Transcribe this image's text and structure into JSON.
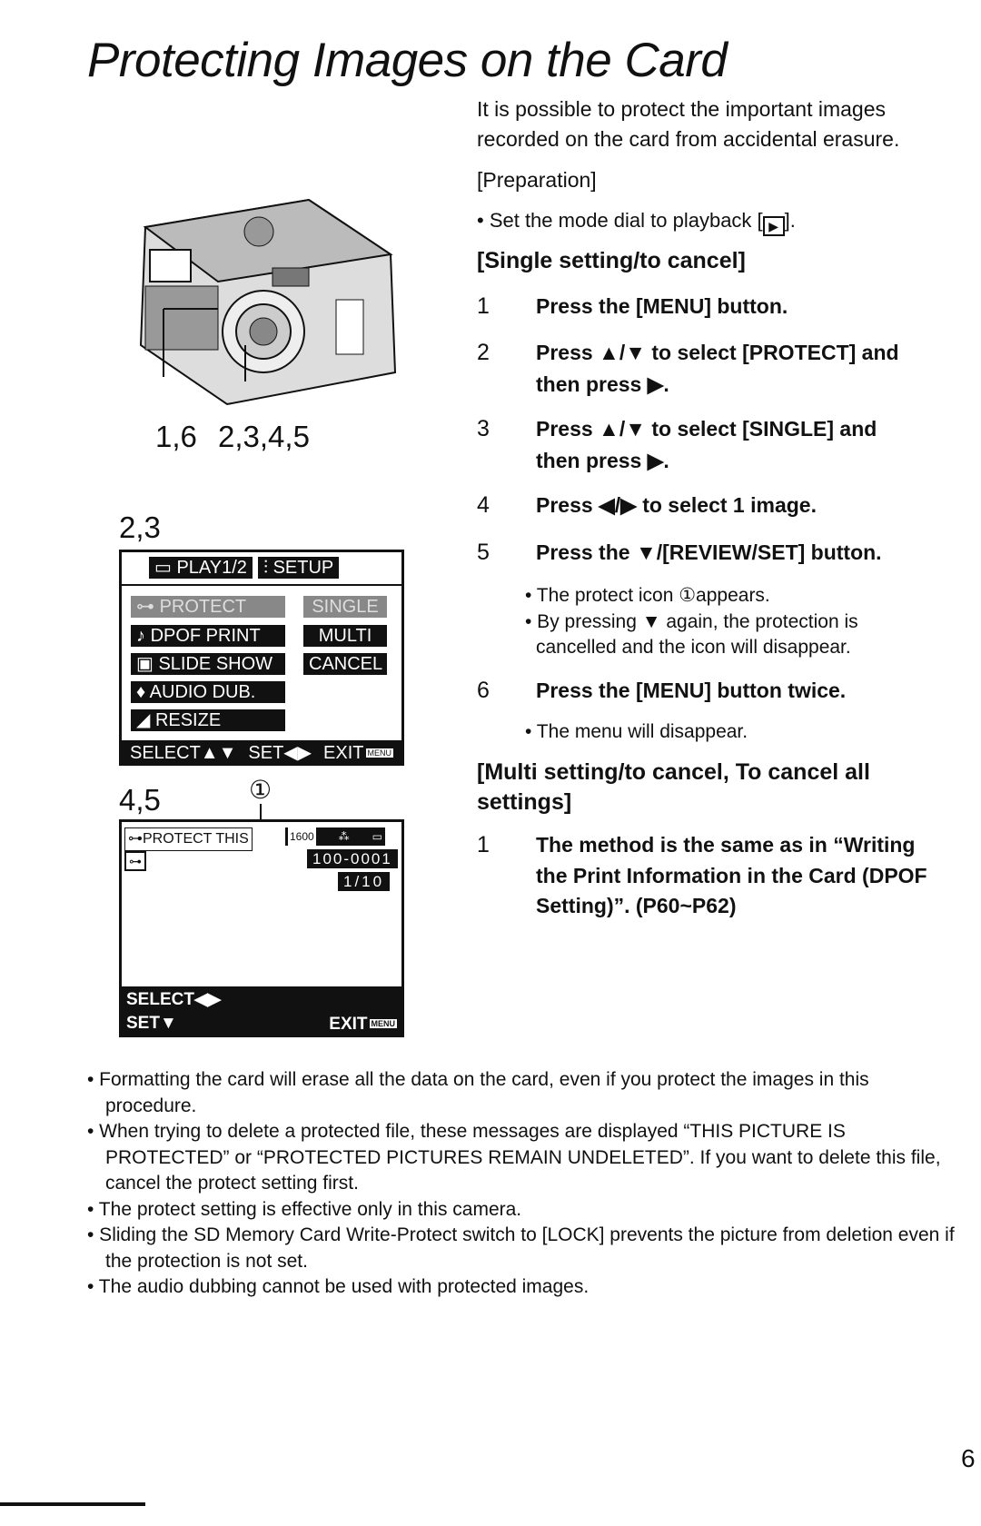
{
  "title": "Protecting Images on the Card",
  "intro": [
    "It is possible to protect the important images",
    "recorded on the card from accidental erasure."
  ],
  "preparation": "[Preparation]",
  "prep_bullet": "• Set the mode dial to playback [",
  "prep_bullet_end": "].",
  "single_heading": "[Single setting/to cancel]",
  "steps": [
    {
      "n": "1",
      "lines": [
        "Press the [MENU] button."
      ]
    },
    {
      "n": "2",
      "lines": [
        "Press ▲/▼ to select [PROTECT] and",
        "then press ▶."
      ]
    },
    {
      "n": "3",
      "lines": [
        "Press ▲/▼ to select [SINGLE] and",
        "then press ▶."
      ]
    },
    {
      "n": "4",
      "lines": [
        "Press ◀/▶ to select 1 image."
      ]
    },
    {
      "n": "5",
      "lines": [
        "Press the ▼/[REVIEW/SET] button."
      ]
    },
    {
      "n": "6",
      "lines": [
        "Press the [MENU] button twice."
      ]
    }
  ],
  "step5_notes": [
    "• The protect icon ①appears.",
    "• By pressing ▼ again, the protection is",
    "cancelled and the icon will disappear."
  ],
  "step6_note": "• The menu will disappear.",
  "multi_heading": [
    "[Multi setting/to cancel, To cancel all",
    "settings]"
  ],
  "multi_step": {
    "n": "1",
    "lines": [
      "The method is the same as in “Writing",
      "the Print Information in the Card (DPOF",
      "Setting)”. (P60~P62)"
    ]
  },
  "camera_labels": {
    "left": "1,6",
    "right": "2,3,4,5"
  },
  "menu_label": "2,3",
  "menu": {
    "tab_play": "PLAY1/2",
    "tab_setup": "SETUP",
    "items": [
      "PROTECT",
      "DPOF PRINT",
      "SLIDE SHOW",
      "AUDIO DUB.",
      "RESIZE"
    ],
    "options": [
      "SINGLE",
      "MULTI",
      "CANCEL"
    ],
    "footer": [
      "SELECT▲▼",
      "SET◀▶",
      "EXIT"
    ],
    "menu_key": "MENU"
  },
  "review_label": "4,5",
  "callout": "①",
  "review": {
    "protect_text": "PROTECT THIS",
    "size": "1600",
    "file": "100-0001",
    "count": "1/10",
    "footer_select": "SELECT◀▶",
    "footer_set": "SET▼",
    "footer_exit": "EXIT",
    "menu_key": "MENU"
  },
  "notes": [
    "• Formatting the card will erase all the data on the card, even if you protect the images in this procedure.",
    "• When trying to delete a protected file, these messages are displayed “THIS PICTURE IS PROTECTED” or “PROTECTED PICTURES REMAIN UNDELETED”. If you want to delete this file, cancel the protect setting first.",
    "• The protect setting is effective only in this camera.",
    "• Sliding the SD Memory Card Write-Protect switch to [LOCK] prevents the picture from deletion even if the protection is not set.",
    "• The audio dubbing cannot be used with protected images."
  ],
  "page_number": "6"
}
